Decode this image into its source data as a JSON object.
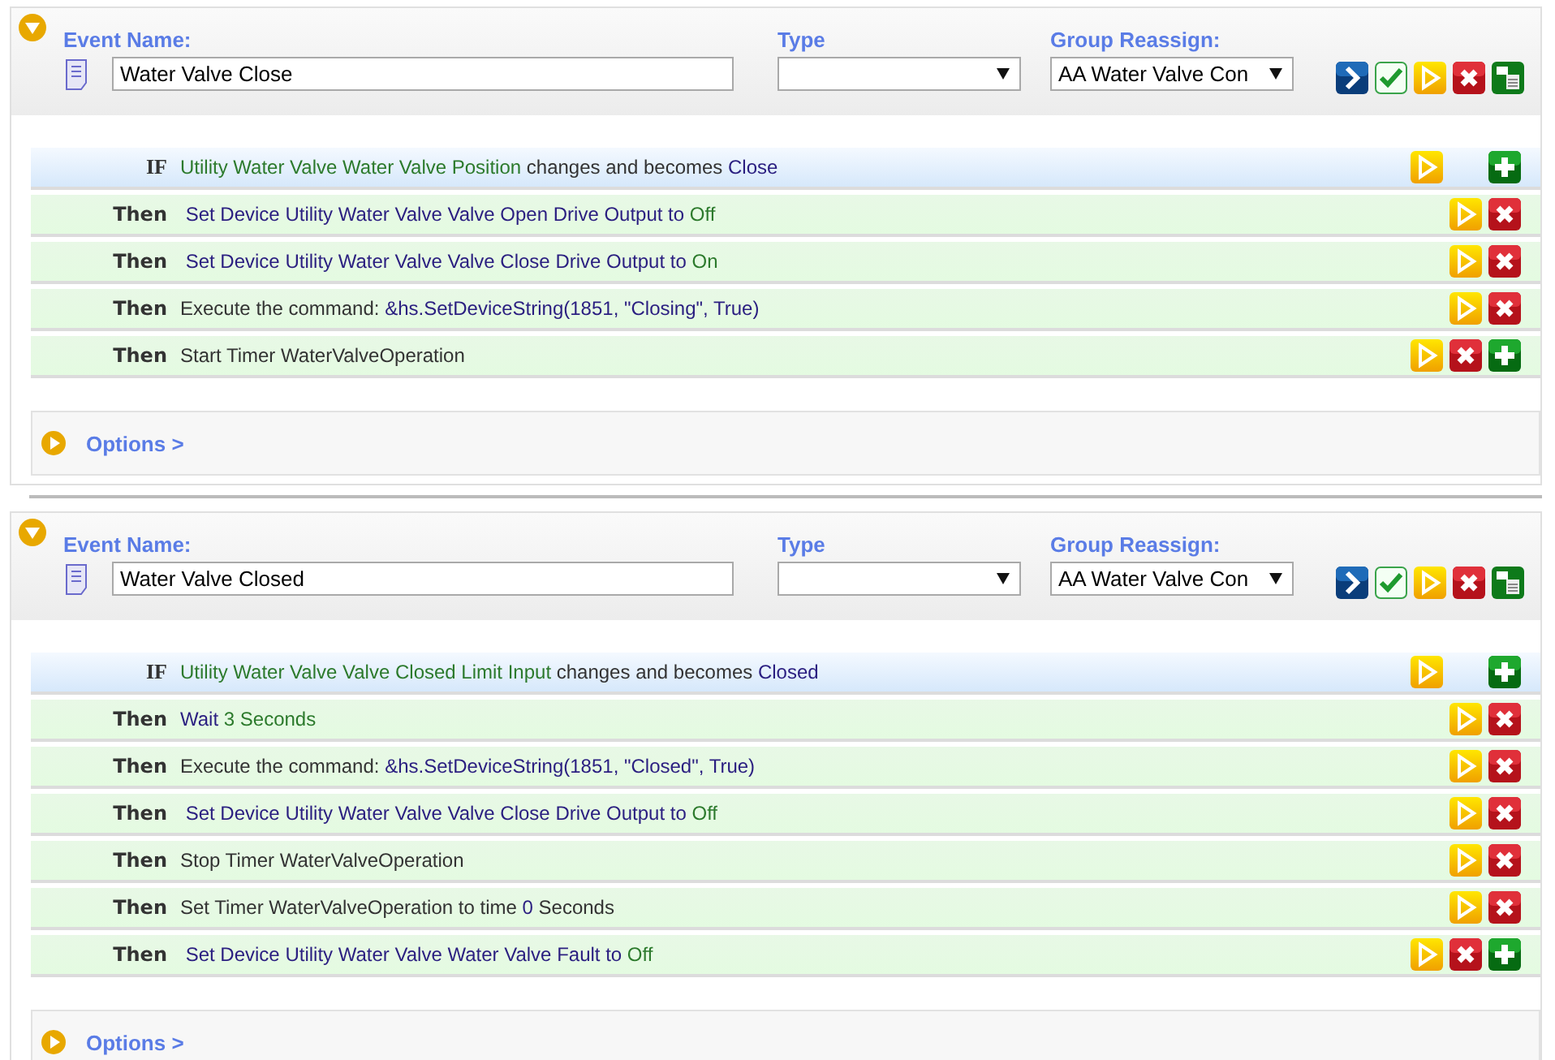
{
  "events": [
    {
      "expanded": true,
      "name_label": "Event Name:",
      "name": "Water Valve Close",
      "type_label": "Type",
      "group_label": "Group Reassign:",
      "group_value": "AA Water Valve Con",
      "toolbar": [
        {
          "kind": "go"
        },
        {
          "kind": "check"
        },
        {
          "kind": "run"
        },
        {
          "kind": "delete"
        },
        {
          "kind": "copy"
        }
      ],
      "rows": [
        {
          "kind": "if",
          "label": "IF",
          "parts": [
            {
              "kind": "term",
              "text": "Utility Water Valve Water Valve Position"
            },
            {
              "kind": "plain",
              "text": " changes and becomes "
            },
            {
              "kind": "value",
              "text": "Close"
            }
          ],
          "buttons": [
            {
              "kind": "run"
            },
            {
              "kind": "gap"
            },
            {
              "kind": "add"
            }
          ]
        },
        {
          "kind": "then",
          "label": "Then",
          "parts": [
            {
              "kind": "value",
              "text": " Set Device Utility Water Valve Valve Open Drive Output to "
            },
            {
              "kind": "term",
              "text": "Off"
            }
          ],
          "buttons": [
            {
              "kind": "run"
            },
            {
              "kind": "delete"
            }
          ]
        },
        {
          "kind": "then",
          "label": "Then",
          "parts": [
            {
              "kind": "value",
              "text": " Set Device Utility Water Valve Valve Close Drive Output to "
            },
            {
              "kind": "term",
              "text": "On"
            }
          ],
          "buttons": [
            {
              "kind": "run"
            },
            {
              "kind": "delete"
            }
          ]
        },
        {
          "kind": "then",
          "label": "Then",
          "parts": [
            {
              "kind": "plain",
              "text": "Execute the command: "
            },
            {
              "kind": "value",
              "text": "&hs.SetDeviceString(1851, \"Closing\", True)"
            }
          ],
          "buttons": [
            {
              "kind": "run"
            },
            {
              "kind": "delete"
            }
          ]
        },
        {
          "kind": "then",
          "label": "Then",
          "parts": [
            {
              "kind": "plain",
              "text": "Start Timer WaterValveOperation"
            }
          ],
          "buttons": [
            {
              "kind": "run"
            },
            {
              "kind": "delete"
            },
            {
              "kind": "add"
            }
          ]
        }
      ],
      "options": "Options >"
    },
    {
      "expanded": true,
      "name_label": "Event Name:",
      "name": "Water Valve Closed",
      "type_label": "Type",
      "group_label": "Group Reassign:",
      "group_value": "AA Water Valve Con",
      "toolbar": [
        {
          "kind": "go"
        },
        {
          "kind": "check"
        },
        {
          "kind": "run"
        },
        {
          "kind": "delete"
        },
        {
          "kind": "copy"
        }
      ],
      "rows": [
        {
          "kind": "if",
          "label": "IF",
          "parts": [
            {
              "kind": "term",
              "text": "Utility Water Valve Valve Closed Limit Input"
            },
            {
              "kind": "plain",
              "text": " changes and becomes "
            },
            {
              "kind": "value",
              "text": "Closed"
            }
          ],
          "buttons": [
            {
              "kind": "run"
            },
            {
              "kind": "gap"
            },
            {
              "kind": "add"
            }
          ]
        },
        {
          "kind": "then",
          "label": "Then",
          "parts": [
            {
              "kind": "value",
              "text": "Wait "
            },
            {
              "kind": "term",
              "text": "3 Seconds"
            }
          ],
          "buttons": [
            {
              "kind": "run"
            },
            {
              "kind": "delete"
            }
          ]
        },
        {
          "kind": "then",
          "label": "Then",
          "parts": [
            {
              "kind": "plain",
              "text": "Execute the command: "
            },
            {
              "kind": "value",
              "text": "&hs.SetDeviceString(1851, \"Closed\", True)"
            }
          ],
          "buttons": [
            {
              "kind": "run"
            },
            {
              "kind": "delete"
            }
          ]
        },
        {
          "kind": "then",
          "label": "Then",
          "parts": [
            {
              "kind": "value",
              "text": " Set Device Utility Water Valve Valve Close Drive Output to "
            },
            {
              "kind": "term",
              "text": "Off"
            }
          ],
          "buttons": [
            {
              "kind": "run"
            },
            {
              "kind": "delete"
            }
          ]
        },
        {
          "kind": "then",
          "label": "Then",
          "parts": [
            {
              "kind": "plain",
              "text": "Stop Timer WaterValveOperation"
            }
          ],
          "buttons": [
            {
              "kind": "run"
            },
            {
              "kind": "delete"
            }
          ]
        },
        {
          "kind": "then",
          "label": "Then",
          "parts": [
            {
              "kind": "plain",
              "text": "Set Timer WaterValveOperation to time "
            },
            {
              "kind": "value",
              "text": "0"
            },
            {
              "kind": "plain",
              "text": " Seconds"
            }
          ],
          "buttons": [
            {
              "kind": "run"
            },
            {
              "kind": "delete"
            }
          ]
        },
        {
          "kind": "then",
          "label": "Then",
          "parts": [
            {
              "kind": "value",
              "text": " Set Device Utility Water Valve Water Valve Fault to "
            },
            {
              "kind": "term",
              "text": "Off"
            }
          ],
          "buttons": [
            {
              "kind": "run"
            },
            {
              "kind": "delete"
            },
            {
              "kind": "add"
            }
          ]
        }
      ],
      "options": "Options >"
    }
  ]
}
